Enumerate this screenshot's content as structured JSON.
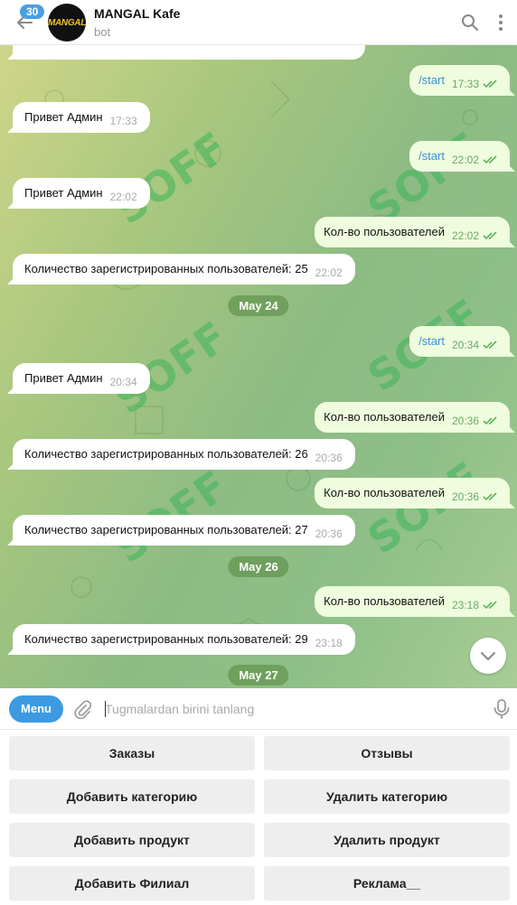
{
  "header": {
    "unread_count": "30",
    "avatar_text": "MANGAL",
    "title": "MANGAL Kafe",
    "subtitle": "bot"
  },
  "messages": [
    {
      "dir": "out",
      "text": "/start",
      "time": "17:33",
      "cmd": true
    },
    {
      "dir": "in",
      "text": "Привет Админ",
      "time": "17:33"
    },
    {
      "dir": "out",
      "text": "/start",
      "time": "22:02",
      "cmd": true
    },
    {
      "dir": "in",
      "text": "Привет Админ",
      "time": "22:02"
    },
    {
      "dir": "out",
      "text": "Кол-во пользователей",
      "time": "22:02"
    },
    {
      "dir": "in",
      "text": "Количество зарегистрированных пользователей: 25",
      "time": "22:02"
    },
    {
      "dir": "date",
      "text": "May 24"
    },
    {
      "dir": "out",
      "text": "/start",
      "time": "20:34",
      "cmd": true
    },
    {
      "dir": "in",
      "text": "Привет Админ",
      "time": "20:34"
    },
    {
      "dir": "out",
      "text": "Кол-во пользователей",
      "time": "20:36"
    },
    {
      "dir": "in",
      "text": "Количество зарегистрированных пользователей: 26",
      "time": "20:36"
    },
    {
      "dir": "out",
      "text": "Кол-во пользователей",
      "time": "20:36"
    },
    {
      "dir": "in",
      "text": "Количество зарегистрированных пользователей: 27",
      "time": "20:36"
    },
    {
      "dir": "date",
      "text": "May 26"
    },
    {
      "dir": "out",
      "text": "Кол-во пользователей",
      "time": "23:18"
    },
    {
      "dir": "in",
      "text": "Количество зарегистрированных пользователей: 29",
      "time": "23:18"
    },
    {
      "dir": "date",
      "text": "May 27"
    }
  ],
  "watermark_text": "SOFF",
  "input": {
    "menu_label": "Menu",
    "placeholder": "Tugmalardan birini tanlang"
  },
  "keyboard": [
    [
      "Заказы",
      "Отзывы"
    ],
    [
      "Добавить категорию",
      "Удалить категорию"
    ],
    [
      "Добавить продукт",
      "Удалить продукт"
    ],
    [
      "Добавить Филиал",
      "Реклама__"
    ]
  ],
  "colors": {
    "accent": "#3d9ae0",
    "out_bubble": "#effdde",
    "in_bubble": "#ffffff",
    "check": "#5fb35f"
  }
}
